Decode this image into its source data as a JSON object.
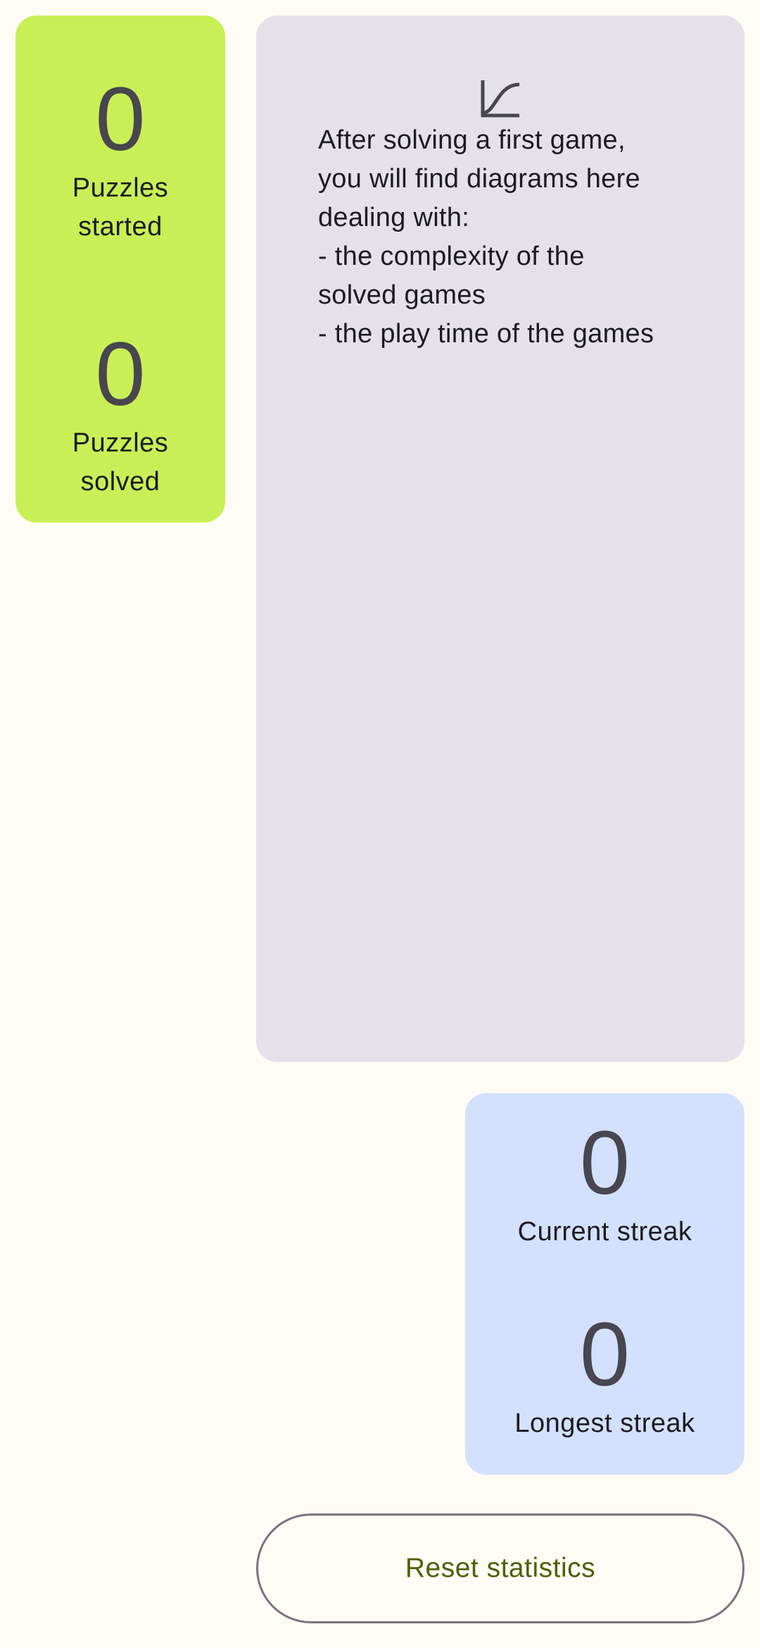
{
  "puzzles": {
    "started_value": "0",
    "started_label": "Puzzles\nstarted",
    "solved_value": "0",
    "solved_label": "Puzzles\nsolved"
  },
  "info": {
    "icon": "chart-curve-icon",
    "text": "After solving a first game,\nyou will find diagrams here\ndealing with:\n- the complexity of the\nsolved games\n- the play time of the games"
  },
  "streaks": {
    "current_value": "0",
    "current_label": "Current streak",
    "longest_value": "0",
    "longest_label": "Longest streak"
  },
  "actions": {
    "reset_label": "Reset statistics"
  },
  "colors": {
    "background": "#fefcf5",
    "puzzles_card": "#c8f056",
    "info_card": "#e5e1e9",
    "streak_card": "#d4e1fe",
    "reset_text": "#4d6108"
  }
}
